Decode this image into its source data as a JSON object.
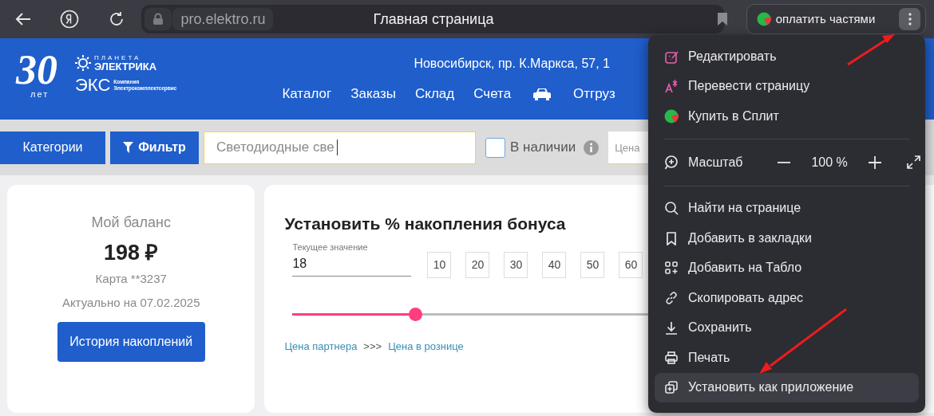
{
  "browser": {
    "url": "pro.elektro.ru",
    "title": "Главная страница",
    "pay_button": "оплатить частями"
  },
  "header": {
    "logo": {
      "years": "30",
      "years_label": "лет",
      "brand_top": "ПЛАНЕТА",
      "brand": "ЭЛЕКТРИКА",
      "company": "ЭКС",
      "company_line1": "Компания",
      "company_line2": "Электрокомплектсервис"
    },
    "address": "Новосибирск, пр. К.Маркса, 57, 1",
    "nav": [
      {
        "kind": "text",
        "label": "Каталог"
      },
      {
        "kind": "text",
        "label": "Заказы"
      },
      {
        "kind": "text",
        "label": "Склад"
      },
      {
        "kind": "text",
        "label": "Счета"
      },
      {
        "kind": "icon"
      },
      {
        "kind": "text",
        "label": "Отгруз"
      }
    ]
  },
  "filter_bar": {
    "categories_button": "Категории",
    "filter_button": "Фильтр",
    "search_value": "Светодиодные све",
    "in_stock": {
      "label": "В наличии",
      "checked": false
    },
    "price_placeholder": "Цена"
  },
  "balance_card": {
    "title": "Мой баланс",
    "amount": "198 ₽",
    "card": "Карта **3237",
    "updated": "Актуально на 07.02.2025",
    "history_button": "История накоплений"
  },
  "bonus_card": {
    "title": "Установить % накопления бонуса",
    "field_label": "Текущее значение",
    "field_value": "18",
    "presets": [
      "10",
      "20",
      "30",
      "40",
      "50",
      "60"
    ],
    "slider": {
      "level": 0.22
    },
    "link_partner": "Цена партнера",
    "separator": ">>>",
    "link_retail": "Цена в рознице"
  },
  "menu": {
    "sections": [
      [
        {
          "kind": "action",
          "label": "Редактировать",
          "selected": false
        },
        {
          "kind": "action",
          "label": "Перевести страницу",
          "selected": false
        },
        {
          "kind": "action",
          "label": "Купить в Сплит",
          "selected": false
        }
      ],
      [
        {
          "kind": "zoom",
          "label": "Масштаб",
          "value": "100 %"
        }
      ],
      [
        {
          "kind": "action",
          "label": "Найти на странице",
          "selected": false
        },
        {
          "kind": "action",
          "label": "Добавить в закладки",
          "selected": false
        },
        {
          "kind": "action",
          "label": "Добавить на Табло",
          "selected": false
        },
        {
          "kind": "action",
          "label": "Скопировать адрес",
          "selected": false
        },
        {
          "kind": "action",
          "label": "Сохранить",
          "selected": false
        },
        {
          "kind": "action",
          "label": "Печать",
          "selected": false
        },
        {
          "kind": "action",
          "label": "Установить как приложение",
          "selected": true
        }
      ]
    ]
  }
}
